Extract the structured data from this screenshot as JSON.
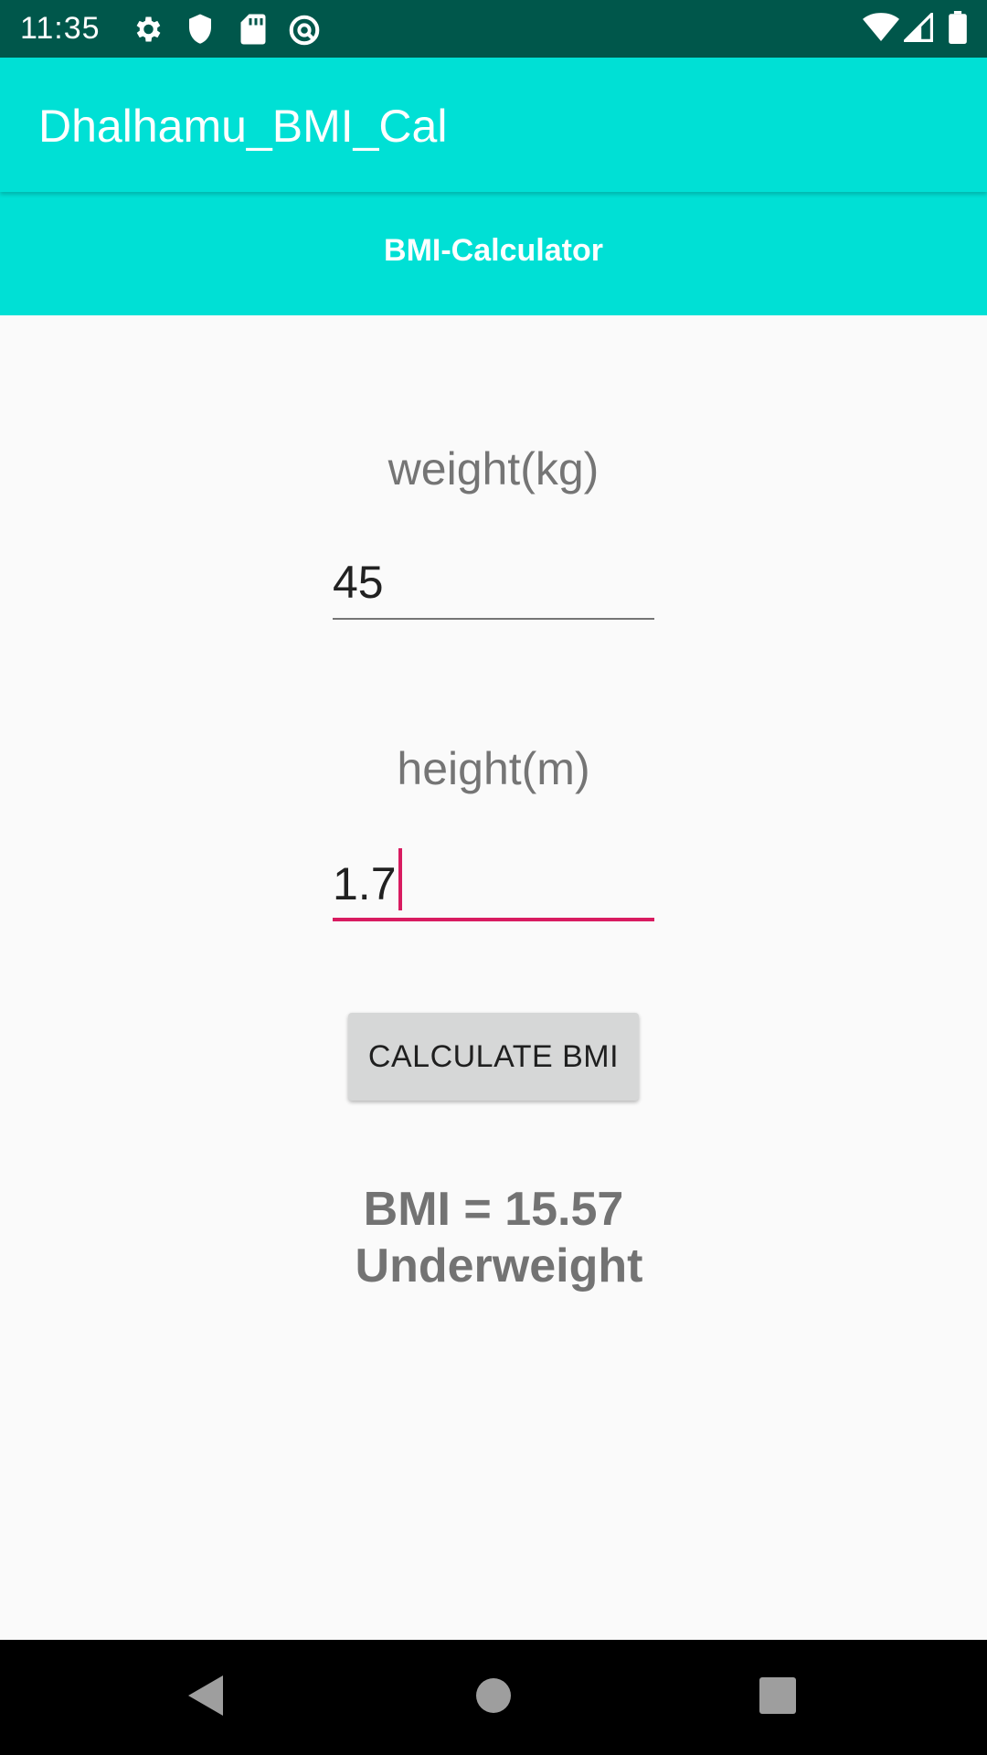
{
  "status_bar": {
    "time": "11:35",
    "left_icons": [
      "gear-icon",
      "shield-icon",
      "sd-card-icon",
      "vpn-icon"
    ],
    "right_icons": [
      "wifi-icon",
      "cell-signal-icon",
      "battery-icon"
    ]
  },
  "app_bar": {
    "title": "Dhalhamu_BMI_Cal"
  },
  "header": {
    "subtitle": "BMI-Calculator"
  },
  "form": {
    "weight_label": "weight(kg)",
    "weight_value": "45",
    "height_label": "height(m)",
    "height_value": "1.7",
    "calculate_label": "CALCULATE BMI"
  },
  "result": {
    "bmi_line": "BMI = 15.57",
    "category": "Underweight"
  },
  "nav_bar": {
    "buttons": [
      "back-icon",
      "home-icon",
      "recents-icon"
    ]
  },
  "colors": {
    "status_bar": "#00574b",
    "app_bar": "#00e0d5",
    "accent": "#d81b60",
    "background": "#fafafa",
    "button": "#d6d7d7"
  }
}
